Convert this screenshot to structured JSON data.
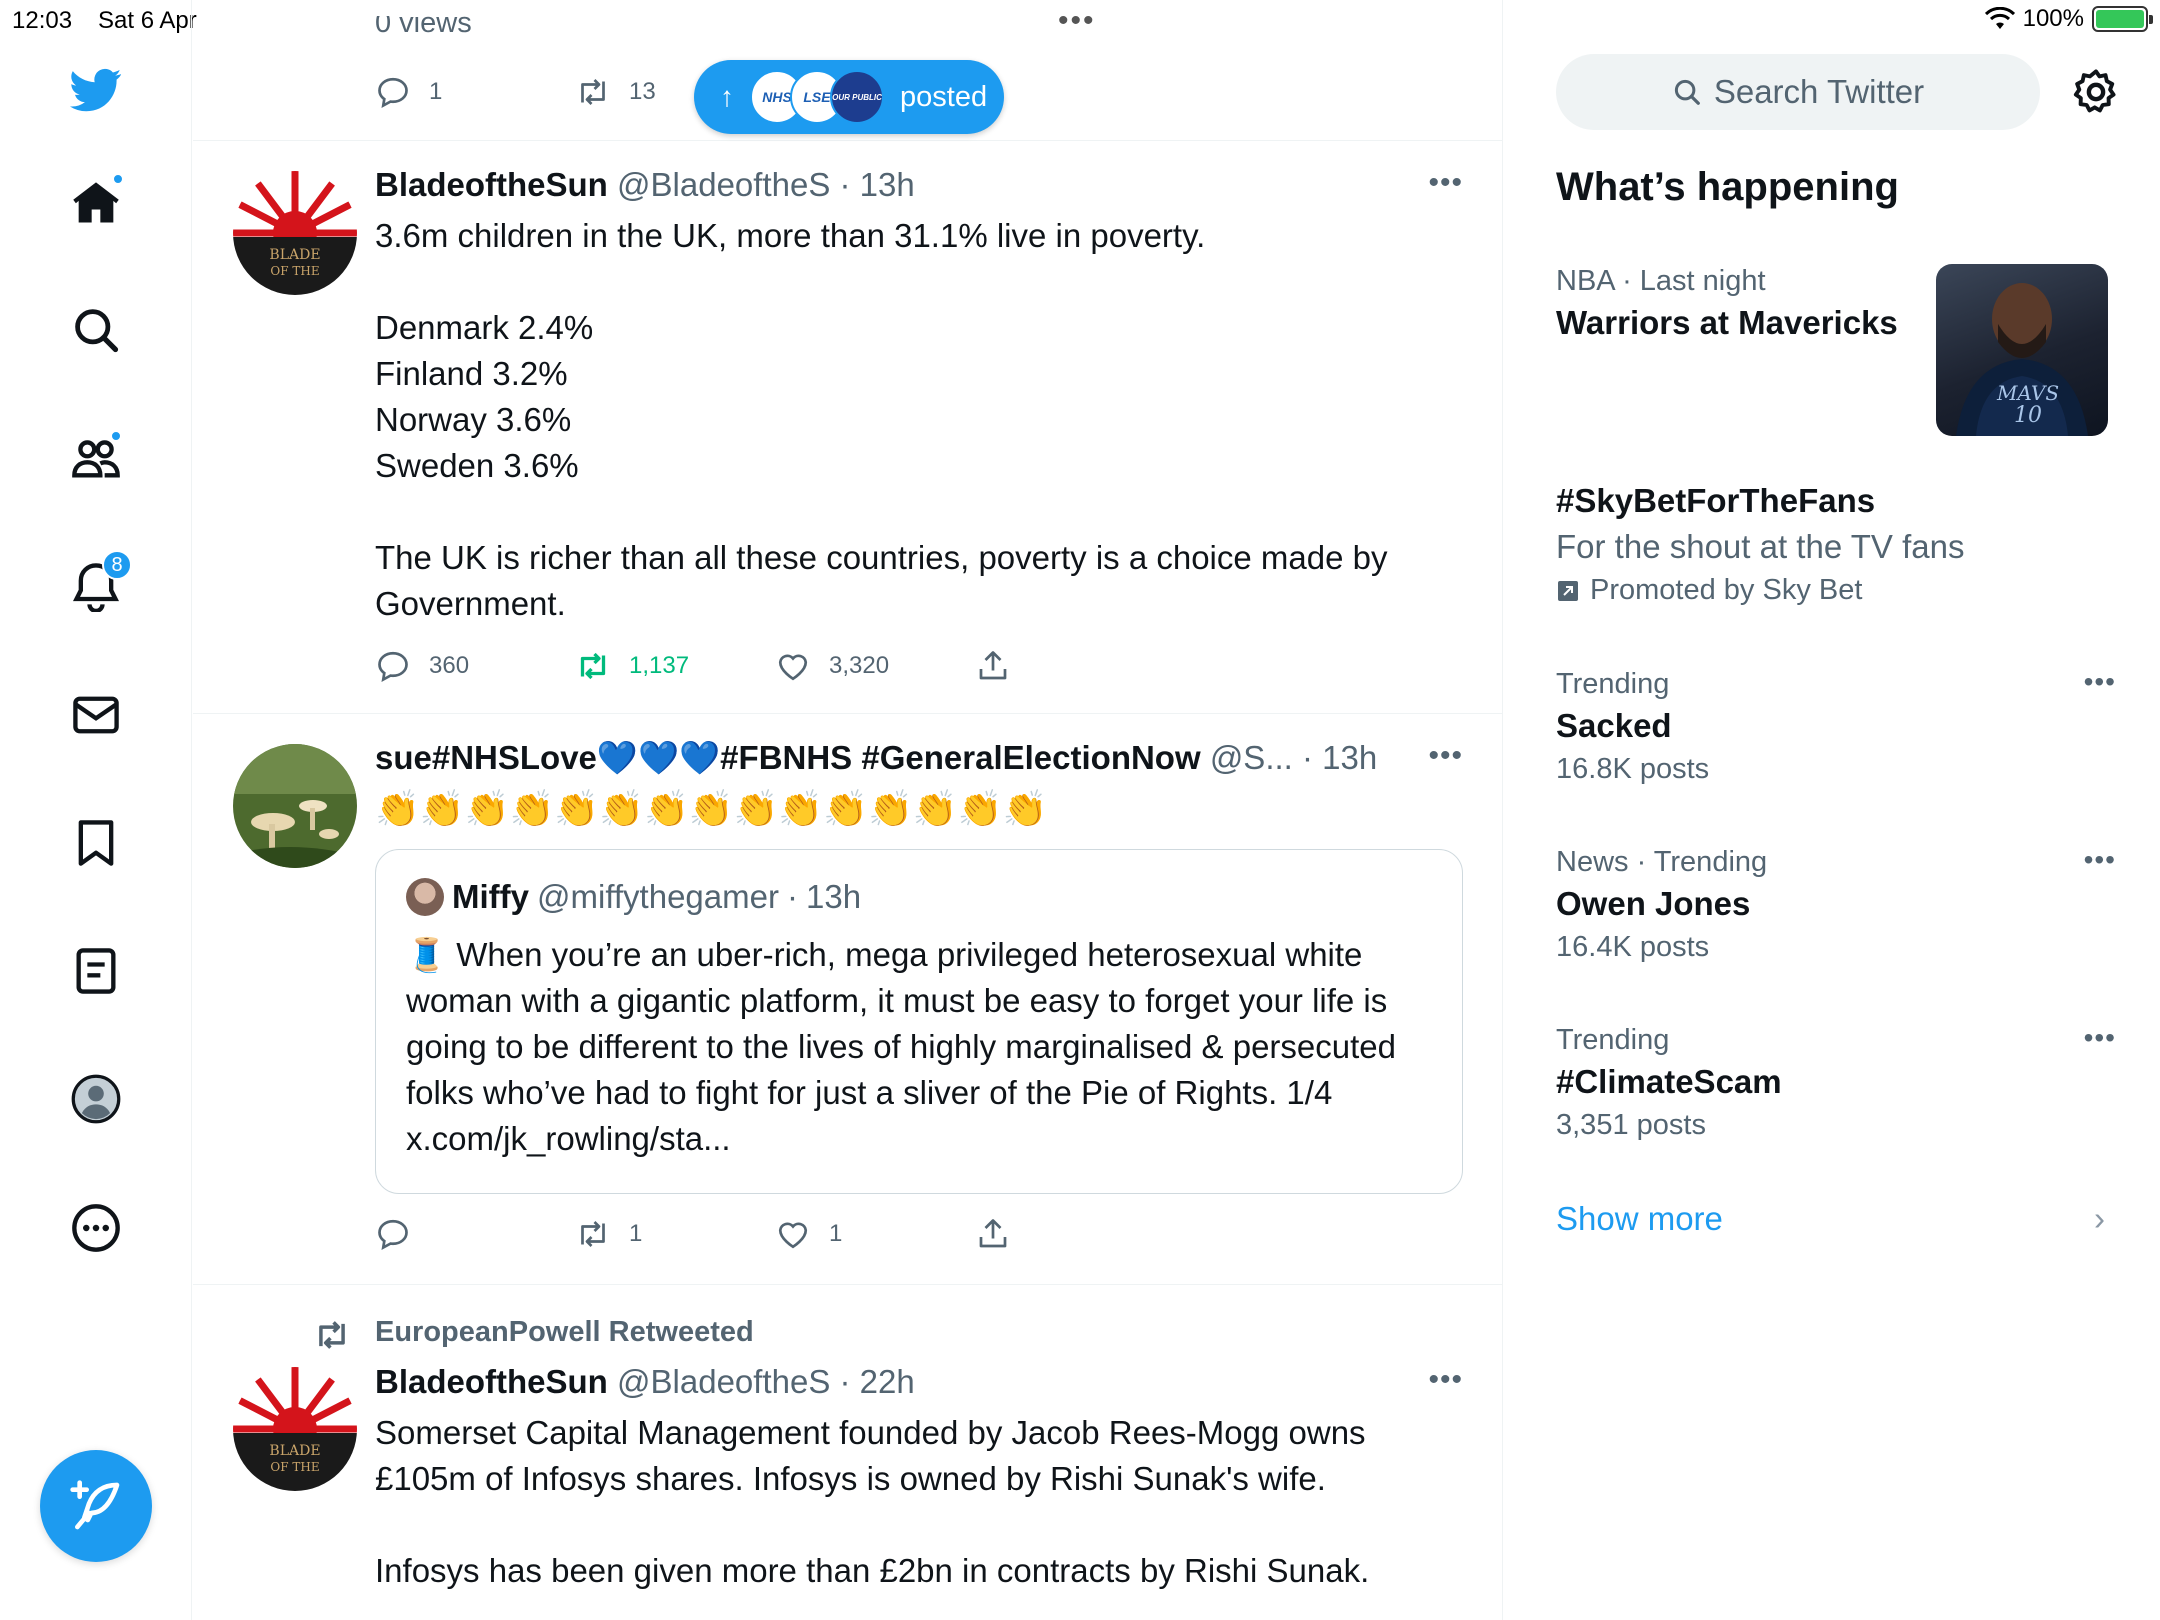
{
  "status_bar": {
    "time": "12:03",
    "date": "Sat 6 Apr",
    "battery": "100%"
  },
  "nav": {
    "notifications_badge": "8"
  },
  "colors": {
    "accent": "#1d9bf0",
    "retweet_green": "#00ba7c",
    "muted": "#536471"
  },
  "posted_pill": {
    "label": "posted",
    "avatars": [
      "NHS",
      "LSE",
      "OUR PUBLIC"
    ]
  },
  "top_partial": {
    "views": "0 views",
    "replies": "1",
    "retweets": "13"
  },
  "tweets": [
    {
      "name": "BladeoftheSun",
      "handle": "@BladeoftheS",
      "time": "13h",
      "avatar_text": "BLADE OF THE",
      "body": "3.6m children in the UK, more than 31.1% live in poverty.\n\nDenmark 2.4%\nFinland 3.2%\nNorway 3.6%\nSweden 3.6%\n\nThe UK is richer than all these countries, poverty is a choice made by Government.",
      "replies": "360",
      "retweets": "1,137",
      "likes": "3,320"
    },
    {
      "name": "sue#NHSLove💙💙💙#FBNHS #GeneralElectionNow",
      "handle": "@S...",
      "time": "13h",
      "body": "👏👏👏👏👏👏👏👏👏👏👏👏👏👏👏",
      "quote": {
        "name": "Miffy",
        "handle": "@miffythegamer",
        "time": "13h",
        "body": "🧵 When you’re an uber-rich, mega privileged heterosexual white woman with a gigantic platform, it must be easy to forget your life is going to be different to the lives of highly marginalised & persecuted folks who’ve had to fight for just a sliver of the Pie of Rights. 1/4 x.com/jk_rowling/sta..."
      },
      "replies": "",
      "retweets": "1",
      "likes": "1"
    },
    {
      "retweeted_by": "EuropeanPowell Retweeted",
      "name": "BladeoftheSun",
      "handle": "@BladeoftheS",
      "time": "22h",
      "avatar_text": "BLADE OF THE",
      "body": "Somerset Capital Management founded by Jacob Rees-Mogg owns £105m of Infosys shares. Infosys is owned by Rishi Sunak's wife.\n\nInfosys has been given more than £2bn in contracts by Rishi Sunak."
    }
  ],
  "sidebar": {
    "search_placeholder": "Search Twitter",
    "title": "What’s happening",
    "trends": [
      {
        "meta": "NBA · Last night",
        "name": "Warriors at Mavericks",
        "image_text": "MAVS 10"
      },
      {
        "name": "#SkyBetForTheFans",
        "desc": "For the shout at the TV fans",
        "promoted": "Promoted by Sky Bet"
      },
      {
        "meta": "Trending",
        "name": "Sacked",
        "count": "16.8K posts"
      },
      {
        "meta": "News · Trending",
        "name": "Owen Jones",
        "count": "16.4K posts"
      },
      {
        "meta": "Trending",
        "name": "#ClimateScam",
        "count": "3,351 posts"
      }
    ],
    "show_more": "Show more"
  }
}
